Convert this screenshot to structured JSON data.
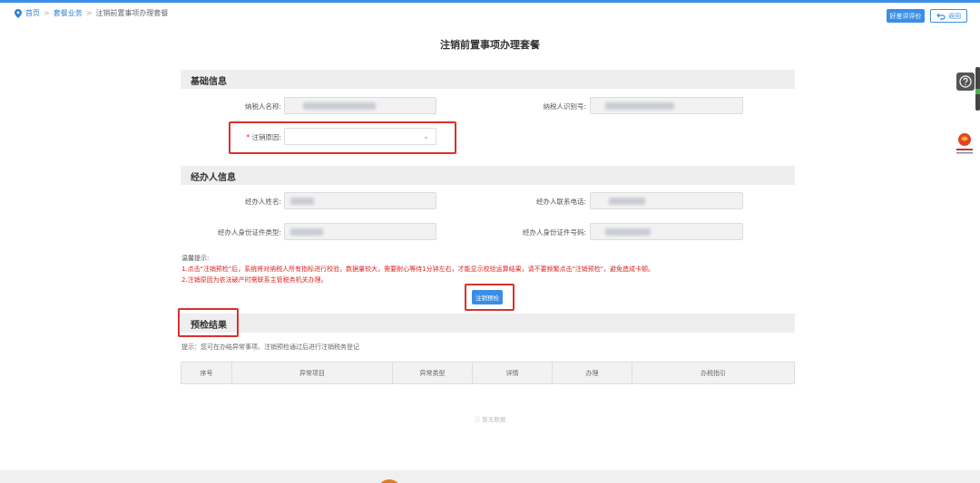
{
  "breadcrumb": {
    "home": "首页",
    "service": "套餐业务",
    "current": "注销前置事项办理套餐"
  },
  "header": {
    "evaluate_label": "好差评评价",
    "back_label": "返回"
  },
  "page": {
    "title": "注销前置事项办理套餐"
  },
  "basic_info": {
    "title": "基础信息",
    "taxpayer_name_label": "纳税人名称:",
    "taxpayer_id_label": "纳税人识别号:",
    "cancel_reason_label": "注销原因:",
    "required_mark": "*"
  },
  "agent_info": {
    "title": "经办人信息",
    "name_label": "经办人姓名:",
    "phone_label": "经办人联系电话:",
    "id_type_label": "经办人身份证件类型:",
    "id_number_label": "经办人身份证件号码:"
  },
  "tips": {
    "title": "温馨提示:",
    "line1": "1.点击\"注销预检\"后，系统将对纳税人所有指标进行校验，数据量较大，需要耐心等待1分钟左右，才能显示校验运算结果，请不要频繁点击\"注销预检\"，避免造成卡顿。",
    "line2": "2.注销原因为依法破产时需联系主管税务机关办理。"
  },
  "actions": {
    "precheck_label": "注销预检"
  },
  "result": {
    "title": "预检结果",
    "hint": "提示：您可在办结异常事项、注销预检通过后进行注销税务登记",
    "columns": [
      "序号",
      "异常项目",
      "异常类型",
      "详情",
      "办理",
      "办税指引"
    ],
    "empty_text": "暂无数据"
  },
  "colors": {
    "primary": "#3a8ee6",
    "highlight": "#d9302c",
    "warning_text": "#e02020"
  }
}
